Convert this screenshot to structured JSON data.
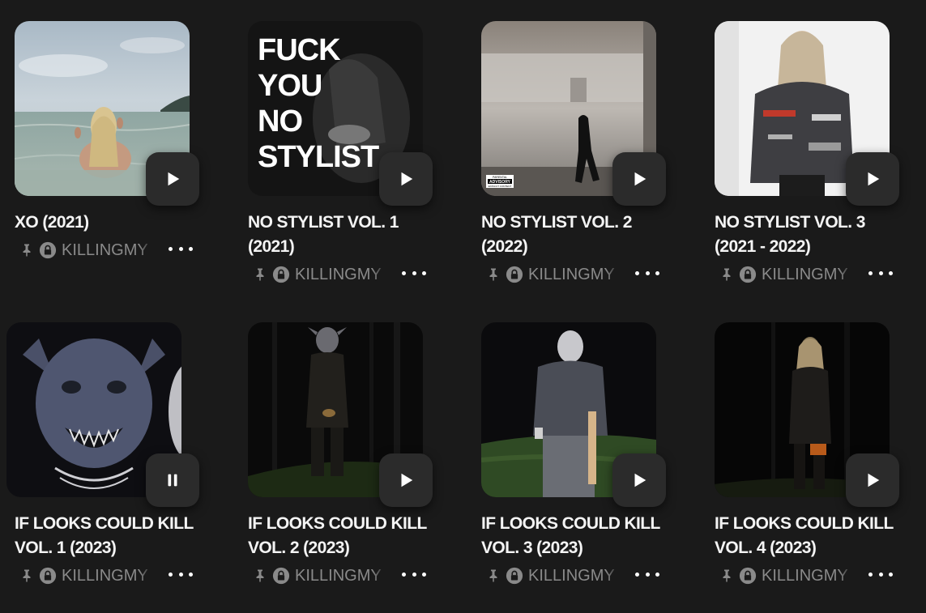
{
  "albums": [
    {
      "title": "XO (2021)",
      "owner": "KILLINGMY",
      "state": "play"
    },
    {
      "title": "NO STYLIST VOL. 1 (2021)",
      "owner": "KILLINGMY",
      "state": "play",
      "cover_text": "FUCK YOU NO STYLIST"
    },
    {
      "title": "NO STYLIST VOL. 2 (2022)",
      "owner": "KILLINGMY",
      "state": "play",
      "cover_text": "PARENTAL ADVISORY EXPLICIT CONTENT"
    },
    {
      "title": "NO STYLIST VOL. 3 (2021 - 2022)",
      "owner": "KILLINGMY",
      "state": "play"
    },
    {
      "title": "IF LOOKS COULD KILL VOL. 1 (2023)",
      "owner": "KILLINGMY",
      "state": "pause"
    },
    {
      "title": "IF LOOKS COULD KILL VOL. 2 (2023)",
      "owner": "KILLINGMY",
      "state": "play"
    },
    {
      "title": "IF LOOKS COULD KILL VOL. 3 (2023)",
      "owner": "KILLINGMY",
      "state": "play"
    },
    {
      "title": "IF LOOKS COULD KILL VOL. 4 (2023)",
      "owner": "KILLINGMY",
      "state": "play"
    }
  ],
  "icons": {
    "pin": "pin-icon",
    "lock": "lock-icon",
    "more": "more-options-icon",
    "play": "play-icon",
    "pause": "pause-icon"
  }
}
